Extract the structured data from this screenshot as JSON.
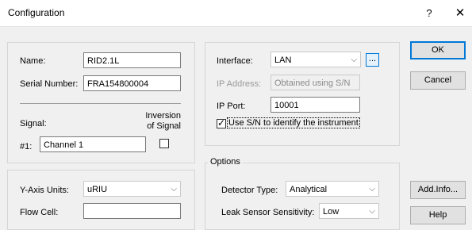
{
  "window": {
    "title": "Configuration",
    "help_label": "?",
    "close_label": "✕"
  },
  "device": {
    "name_label": "Name:",
    "name_value": "RID2.1L",
    "serial_label": "Serial Number:",
    "serial_value": "FRA154800004",
    "signal_label": "Signal:",
    "inversion_label_1": "Inversion",
    "inversion_label_2": "of Signal",
    "channel_label": "#1:",
    "channel_value": "Channel 1",
    "inversion_checked": false
  },
  "connection": {
    "interface_label": "Interface:",
    "interface_value": "LAN",
    "ellipsis_label": "...",
    "ip_address_label": "IP Address:",
    "ip_address_value": "Obtained using S/N",
    "ip_port_label": "IP Port:",
    "ip_port_value": "10001",
    "use_sn_label": "Use S/N to identify the instrument",
    "use_sn_checked": true
  },
  "units": {
    "y_axis_label": "Y-Axis Units:",
    "y_axis_value": "uRIU",
    "flow_cell_label": "Flow Cell:",
    "flow_cell_value": ""
  },
  "options": {
    "group_label": "Options",
    "detector_type_label": "Detector Type:",
    "detector_type_value": "Analytical",
    "leak_sensor_label": "Leak Sensor Sensitivity:",
    "leak_sensor_value": "Low"
  },
  "buttons": {
    "ok": "OK",
    "cancel": "Cancel",
    "add_info": "Add.Info...",
    "help": "Help"
  },
  "icons": {
    "dropdown": "chevron-down-icon",
    "check": "checkmark-icon"
  }
}
